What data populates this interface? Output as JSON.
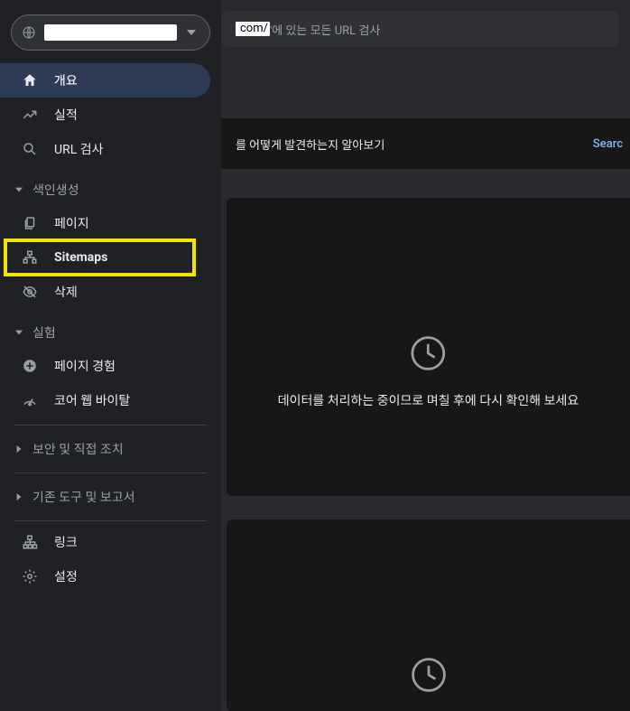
{
  "searchbar": {
    "domain_suffix": "com/",
    "rest_text": "'에 있는 모든 URL 검사"
  },
  "banner": {
    "text": "를 어떻게 발견하는지 알아보기",
    "link": "Searc"
  },
  "card_message": "데이터를 처리하는 중이므로 며칠 후에 다시 확인해 보세요",
  "sidebar": {
    "sections": {
      "top": [
        {
          "label": "개요"
        },
        {
          "label": "실적"
        },
        {
          "label": "URL 검사"
        }
      ],
      "indexing": {
        "title": "색인생성",
        "items": [
          {
            "label": "페이지"
          },
          {
            "label": "Sitemaps"
          },
          {
            "label": "삭제"
          }
        ]
      },
      "experience": {
        "title": "실험",
        "items": [
          {
            "label": "페이지 경험"
          },
          {
            "label": "코어 웹 바이탈"
          }
        ]
      },
      "security": {
        "title": "보안 및 직접 조치"
      },
      "legacy": {
        "title": "기존 도구 및 보고서"
      },
      "bottom": [
        {
          "label": "링크"
        },
        {
          "label": "설정"
        }
      ]
    }
  }
}
